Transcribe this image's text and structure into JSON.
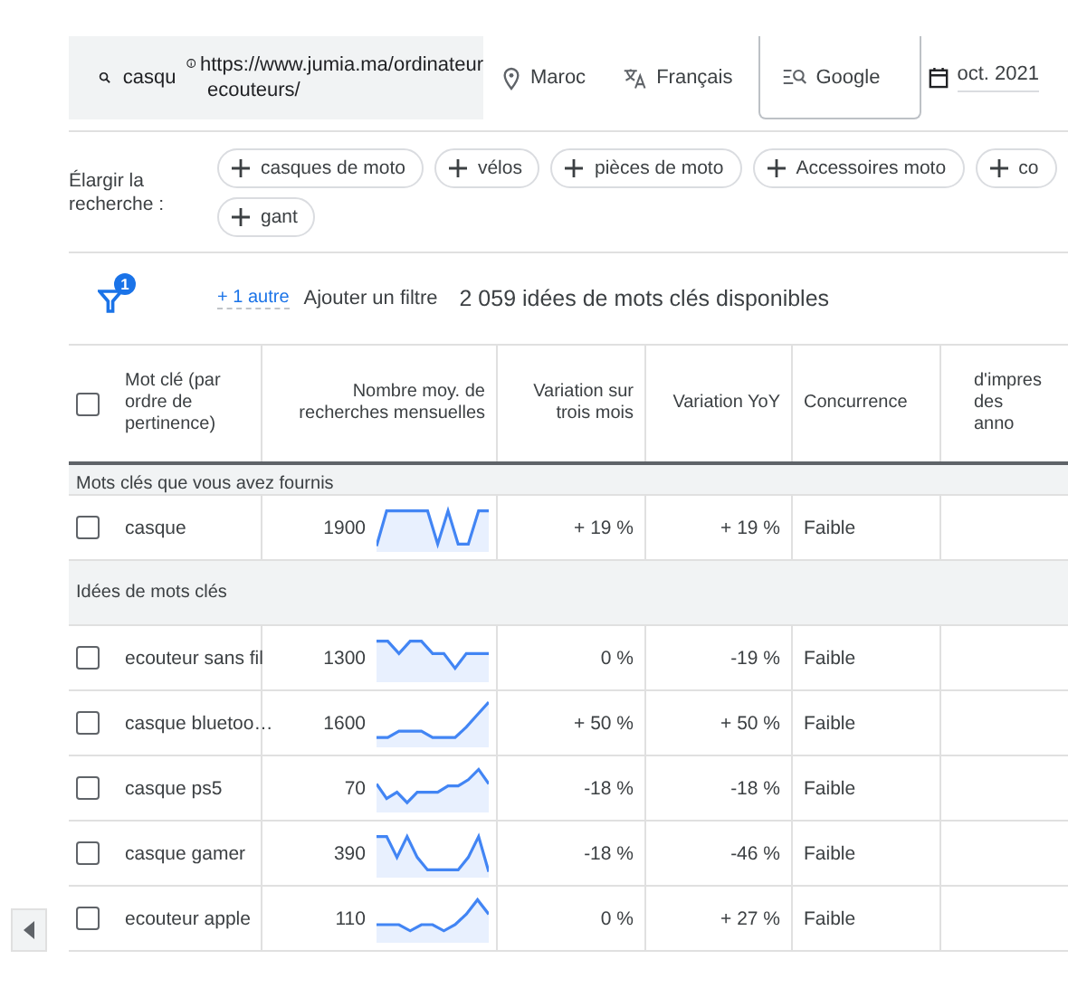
{
  "search": {
    "query": "casqu",
    "url_lines": [
      "https://www.jumia.ma/ordinateur",
      "ecouteurs/"
    ]
  },
  "location": "Maroc",
  "language": "Français",
  "network": "Google",
  "date": "oct. 2021",
  "broaden": {
    "label": "Élargir la recherche :",
    "chips": [
      "casques de moto",
      "vélos",
      "pièces de moto",
      "Accessoires moto",
      "co",
      "gant"
    ]
  },
  "filters": {
    "badge": "1",
    "more_link": "+ 1 autre",
    "add_filter": "Ajouter un filtre",
    "count": "2 059 idées de mots clés disponibles"
  },
  "table": {
    "columns": [
      "Mot clé (par ordre de pertinence)",
      "Nombre moy. de recherches mensuelles",
      "Variation sur trois mois",
      "Variation YoY",
      "Concurrence",
      "d'impres des anno"
    ],
    "header_checked": false,
    "rows": [
      {
        "kind": "group",
        "label": "Mots clés que vous avez fournis"
      },
      {
        "kind": "keyword",
        "keyword": "casque",
        "searches": "1900",
        "three_month": "+ 19 %",
        "yoy": "+ 19 %",
        "competition": "Faible",
        "checked": false
      },
      {
        "kind": "group",
        "label": "Idées de mots clés"
      },
      {
        "kind": "keyword",
        "keyword": "ecouteur sans fil",
        "searches": "1300",
        "three_month": "0 %",
        "yoy": "-19 %",
        "competition": "Faible",
        "checked": false
      },
      {
        "kind": "keyword",
        "keyword": "casque bluetoo…",
        "searches": "1600",
        "three_month": "+ 50 %",
        "yoy": "+ 50 %",
        "competition": "Faible",
        "checked": false
      },
      {
        "kind": "keyword",
        "keyword": "casque ps5",
        "searches": "70",
        "three_month": "-18 %",
        "yoy": "-18 %",
        "competition": "Faible",
        "checked": false
      },
      {
        "kind": "keyword",
        "keyword": "casque gamer",
        "searches": "390",
        "three_month": "-18 %",
        "yoy": "-46 %",
        "competition": "Faible",
        "checked": false
      },
      {
        "kind": "keyword",
        "keyword": "ecouteur apple",
        "searches": "110",
        "three_month": "0 %",
        "yoy": "+ 27 %",
        "competition": "Faible",
        "checked": false
      }
    ]
  }
}
